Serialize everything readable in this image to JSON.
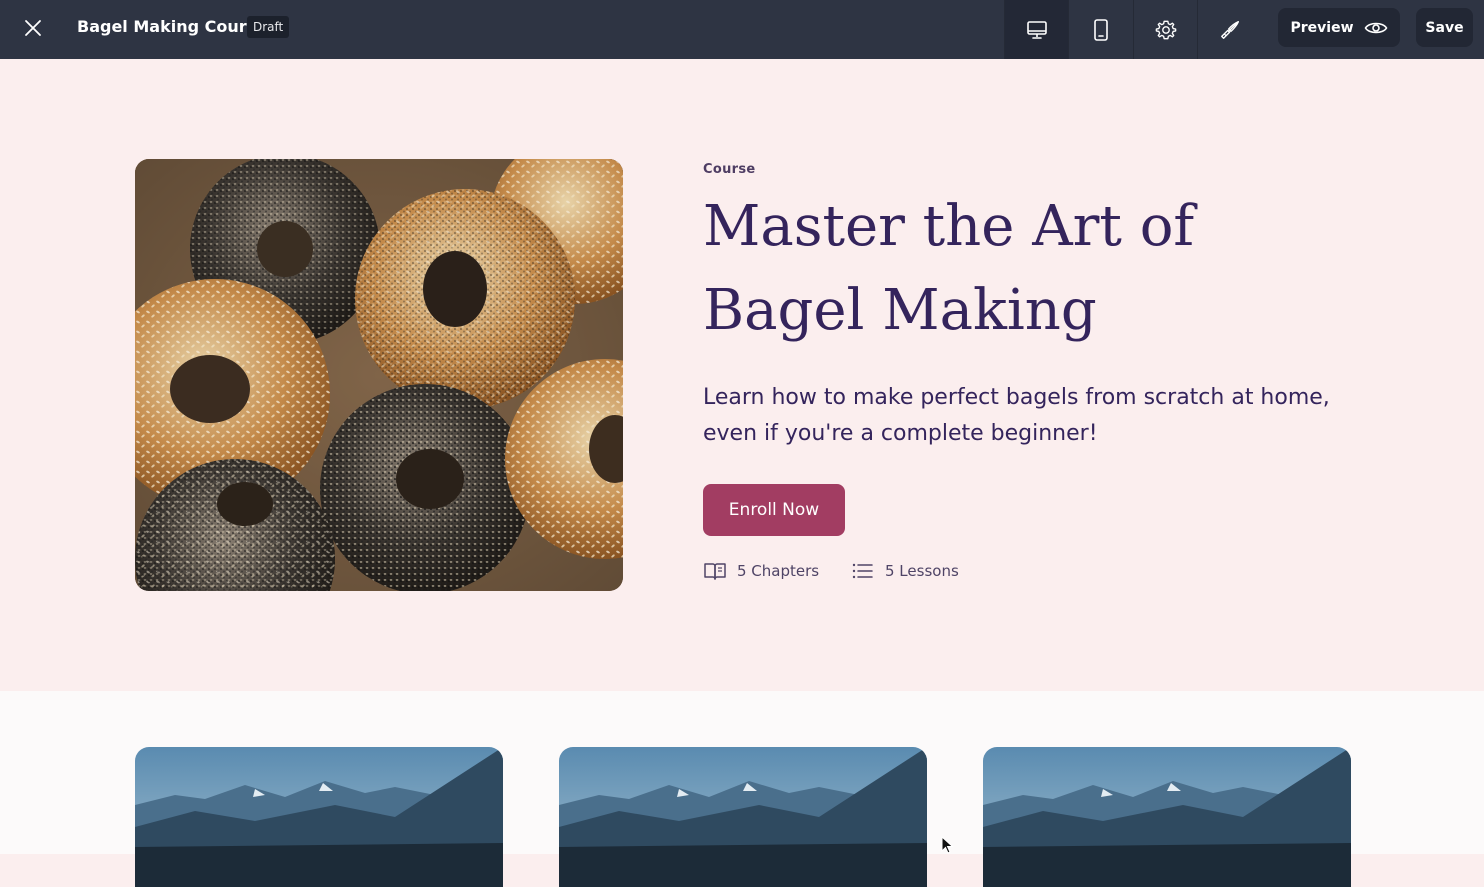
{
  "toolbar": {
    "doc_title": "Bagel Making Course",
    "status_badge": "Draft",
    "preview_label": "Preview",
    "save_label": "Save",
    "view_modes": [
      "desktop",
      "mobile"
    ],
    "active_view": "desktop"
  },
  "hero": {
    "eyebrow": "Course",
    "title": "Master the Art of Bagel Making",
    "description": "Learn how to make perfect bagels from scratch at home, even if you're a complete beginner!",
    "cta_label": "Enroll Now",
    "chapters": "5 Chapters",
    "lessons": "5 Lessons"
  },
  "colors": {
    "toolbar_bg": "#2e3443",
    "hero_bg": "#fbeeee",
    "title": "#34245c",
    "accent": "#a23d62"
  },
  "cards": [
    {
      "image": "mountain-lake"
    },
    {
      "image": "mountain-lake"
    },
    {
      "image": "mountain-lake"
    }
  ]
}
